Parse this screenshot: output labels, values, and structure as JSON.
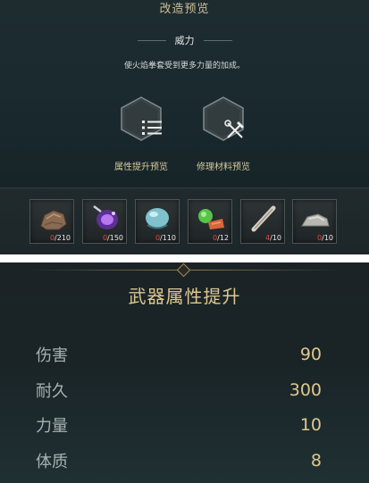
{
  "upgrade_preview": {
    "title": "改造预览",
    "section_label": "威力",
    "description": "使火焰拳套受到更多力量的加成。",
    "buttons": [
      {
        "label": "属性提升预览",
        "icon": "list-icon"
      },
      {
        "label": "修理材料预览",
        "icon": "repair-tools-icon"
      }
    ],
    "materials": [
      {
        "icon": "ore-icon",
        "have": "0",
        "need": "/210",
        "have_color": "#e04a3c"
      },
      {
        "icon": "purple-crystal-icon",
        "have": "0",
        "need": "/150",
        "have_color": "#e04a3c"
      },
      {
        "icon": "blue-slime-icon",
        "have": "0",
        "need": "/110",
        "have_color": "#e04a3c"
      },
      {
        "icon": "herb-fruit-icon",
        "have": "0",
        "need": "/12",
        "have_color": "#e04a3c"
      },
      {
        "icon": "bone-icon",
        "have": "4",
        "need": "/10",
        "have_color": "#e04a3c"
      },
      {
        "icon": "stone-icon",
        "have": "0",
        "need": "/10",
        "have_color": "#e04a3c"
      }
    ]
  },
  "weapon_stats": {
    "title": "武器属性提升",
    "rows": [
      {
        "name": "伤害",
        "value": "90"
      },
      {
        "name": "耐久",
        "value": "300"
      },
      {
        "name": "力量",
        "value": "10"
      },
      {
        "name": "体质",
        "value": "8"
      }
    ]
  },
  "colors": {
    "gold_text": "#dcc98f",
    "shortage_red": "#e04a3c",
    "panel_bg": "#1a2a2f"
  }
}
